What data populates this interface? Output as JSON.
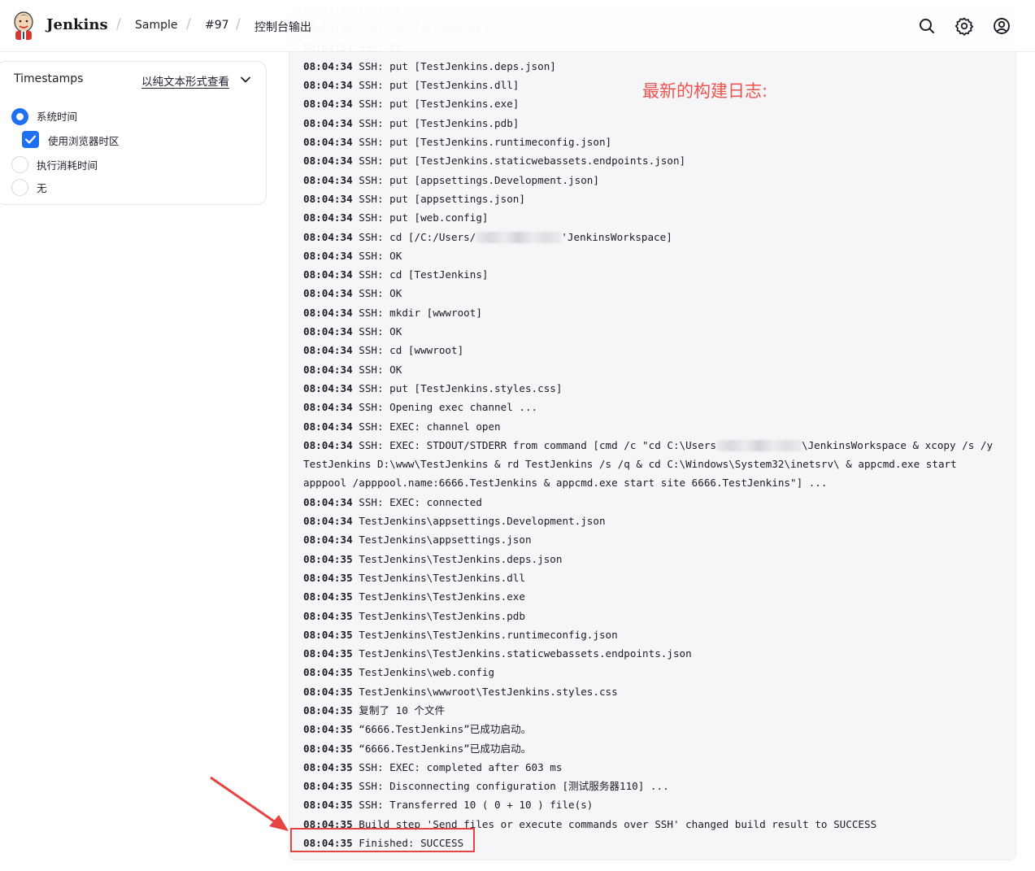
{
  "header": {
    "brand": "Jenkins",
    "breadcrumbs": [
      "Sample",
      "#97",
      "控制台输出"
    ],
    "icons": [
      "search-icon",
      "gear-icon",
      "user-icon"
    ]
  },
  "panel": {
    "title": "Timestamps",
    "view_plain_link": "以纯文本形式查看",
    "options": {
      "system_time": "系统时间",
      "browser_timezone": "使用浏览器时区",
      "elapsed_time": "执行消耗时间",
      "none": "无"
    },
    "selected": "system_time",
    "browser_timezone_checked": true
  },
  "annotation": "最新的构建日志:",
  "console": {
    "faded_lines": [
      {
        "ts": "08:04:34",
        "text": " SSH: OK"
      },
      {
        "ts": "08:04:34",
        "text": " SSH: cd [TestJenkins]"
      },
      {
        "ts": "08:04:34",
        "text": " SSH: OK"
      }
    ],
    "lines": [
      {
        "ts": "08:04:34",
        "text": " SSH: put [TestJenkins.deps.json]"
      },
      {
        "ts": "08:04:34",
        "text": " SSH: put [TestJenkins.dll]"
      },
      {
        "ts": "08:04:34",
        "text": " SSH: put [TestJenkins.exe]"
      },
      {
        "ts": "08:04:34",
        "text": " SSH: put [TestJenkins.pdb]"
      },
      {
        "ts": "08:04:34",
        "text": " SSH: put [TestJenkins.runtimeconfig.json]"
      },
      {
        "ts": "08:04:34",
        "text": " SSH: put [TestJenkins.staticwebassets.endpoints.json]"
      },
      {
        "ts": "08:04:34",
        "text": " SSH: put [appsettings.Development.json]"
      },
      {
        "ts": "08:04:34",
        "text": " SSH: put [appsettings.json]"
      },
      {
        "ts": "08:04:34",
        "text": " SSH: put [web.config]"
      },
      {
        "ts": "08:04:34",
        "text": " SSH: cd [/C:/Users/",
        "blur": true,
        "after": "'JenkinsWorkspace]"
      },
      {
        "ts": "08:04:34",
        "text": " SSH: OK"
      },
      {
        "ts": "08:04:34",
        "text": " SSH: cd [TestJenkins]"
      },
      {
        "ts": "08:04:34",
        "text": " SSH: OK"
      },
      {
        "ts": "08:04:34",
        "text": " SSH: mkdir [wwwroot]"
      },
      {
        "ts": "08:04:34",
        "text": " SSH: OK"
      },
      {
        "ts": "08:04:34",
        "text": " SSH: cd [wwwroot]"
      },
      {
        "ts": "08:04:34",
        "text": " SSH: OK"
      },
      {
        "ts": "08:04:34",
        "text": " SSH: put [TestJenkins.styles.css]"
      },
      {
        "ts": "08:04:34",
        "text": " SSH: Opening exec channel ..."
      },
      {
        "ts": "08:04:34",
        "text": " SSH: EXEC: channel open"
      },
      {
        "ts": "08:04:34",
        "text": " SSH: EXEC: STDOUT/STDERR from command [cmd /c \"cd C:\\Users",
        "blur": true,
        "after": "\\JenkinsWorkspace & xcopy /s /y TestJenkins D:\\www\\TestJenkins & rd TestJenkins /s /q & cd C:\\Windows\\System32\\inetsrv\\ & appcmd.exe start apppool /apppool.name:6666.TestJenkins & appcmd.exe start site 6666.TestJenkins\"] ...",
        "wrap": true
      },
      {
        "ts": "08:04:34",
        "text": " SSH: EXEC: connected"
      },
      {
        "ts": "08:04:34",
        "text": " TestJenkins\\appsettings.Development.json"
      },
      {
        "ts": "08:04:34",
        "text": " TestJenkins\\appsettings.json"
      },
      {
        "ts": "08:04:35",
        "text": " TestJenkins\\TestJenkins.deps.json"
      },
      {
        "ts": "08:04:35",
        "text": " TestJenkins\\TestJenkins.dll"
      },
      {
        "ts": "08:04:35",
        "text": " TestJenkins\\TestJenkins.exe"
      },
      {
        "ts": "08:04:35",
        "text": " TestJenkins\\TestJenkins.pdb"
      },
      {
        "ts": "08:04:35",
        "text": " TestJenkins\\TestJenkins.runtimeconfig.json"
      },
      {
        "ts": "08:04:35",
        "text": " TestJenkins\\TestJenkins.staticwebassets.endpoints.json"
      },
      {
        "ts": "08:04:35",
        "text": " TestJenkins\\web.config"
      },
      {
        "ts": "08:04:35",
        "text": " TestJenkins\\wwwroot\\TestJenkins.styles.css"
      },
      {
        "ts": "08:04:35",
        "text": " 复制了 10 个文件"
      },
      {
        "ts": "08:04:35",
        "text": " “6666.TestJenkins”已成功启动。"
      },
      {
        "ts": "08:04:35",
        "text": " “6666.TestJenkins”已成功启动。"
      },
      {
        "ts": "08:04:35",
        "text": " SSH: EXEC: completed after 603 ms"
      },
      {
        "ts": "08:04:35",
        "text": " SSH: Disconnecting configuration [测试服务器110] ..."
      },
      {
        "ts": "08:04:35",
        "text": " SSH: Transferred 10 ( 0 + 10 ) file(s)"
      },
      {
        "ts": "08:04:35",
        "text": " Build step 'Send files or execute commands over SSH' changed build result to SUCCESS"
      },
      {
        "ts": "08:04:35",
        "text": " Finished: SUCCESS"
      }
    ]
  },
  "colors": {
    "accent": "#1f6ff5",
    "annotation": "#ef5350",
    "console_bg": "#f6f6f8"
  }
}
